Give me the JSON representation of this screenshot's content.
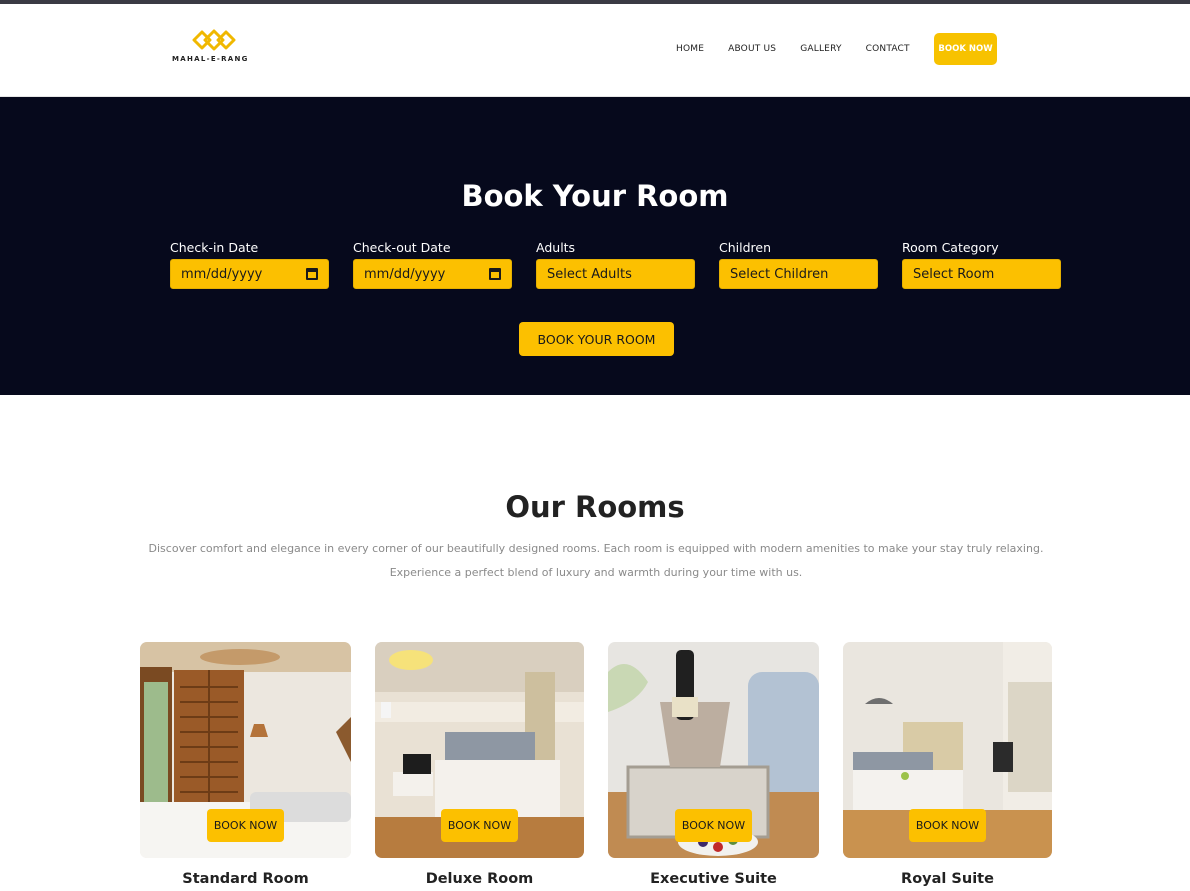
{
  "header": {
    "logo_text": "MAHAL-E-RANG",
    "nav": [
      "HOME",
      "ABOUT US",
      "GALLERY",
      "CONTACT"
    ],
    "book_now_label": "BOOK NOW"
  },
  "booking": {
    "title": "Book Your Room",
    "fields": [
      {
        "label": "Check-in Date",
        "value": "mm/dd/yyyy",
        "type": "date"
      },
      {
        "label": "Check-out Date",
        "value": "mm/dd/yyyy",
        "type": "date"
      },
      {
        "label": "Adults",
        "value": "Select Adults",
        "type": "select"
      },
      {
        "label": "Children",
        "value": "Select Children",
        "type": "select"
      },
      {
        "label": "Room Category",
        "value": "Select Room",
        "type": "select"
      }
    ],
    "submit_label": "BOOK YOUR ROOM"
  },
  "rooms": {
    "title": "Our Rooms",
    "description_line1": "Discover comfort and elegance in every corner of our beautifully designed rooms. Each room is equipped with modern amenities to make your stay truly relaxing.",
    "description_line2": "Experience a perfect blend of luxury and warmth during your time with us.",
    "cards": [
      {
        "name": "Standard Room",
        "button": "BOOK NOW"
      },
      {
        "name": "Deluxe Room",
        "button": "BOOK NOW"
      },
      {
        "name": "Executive Suite",
        "button": "BOOK NOW"
      },
      {
        "name": "Royal Suite",
        "button": "BOOK NOW"
      }
    ]
  },
  "colors": {
    "accent": "#fcc000",
    "hero_bg": "#06091c",
    "text_dark": "#222222",
    "text_muted": "#8a8a8a"
  }
}
